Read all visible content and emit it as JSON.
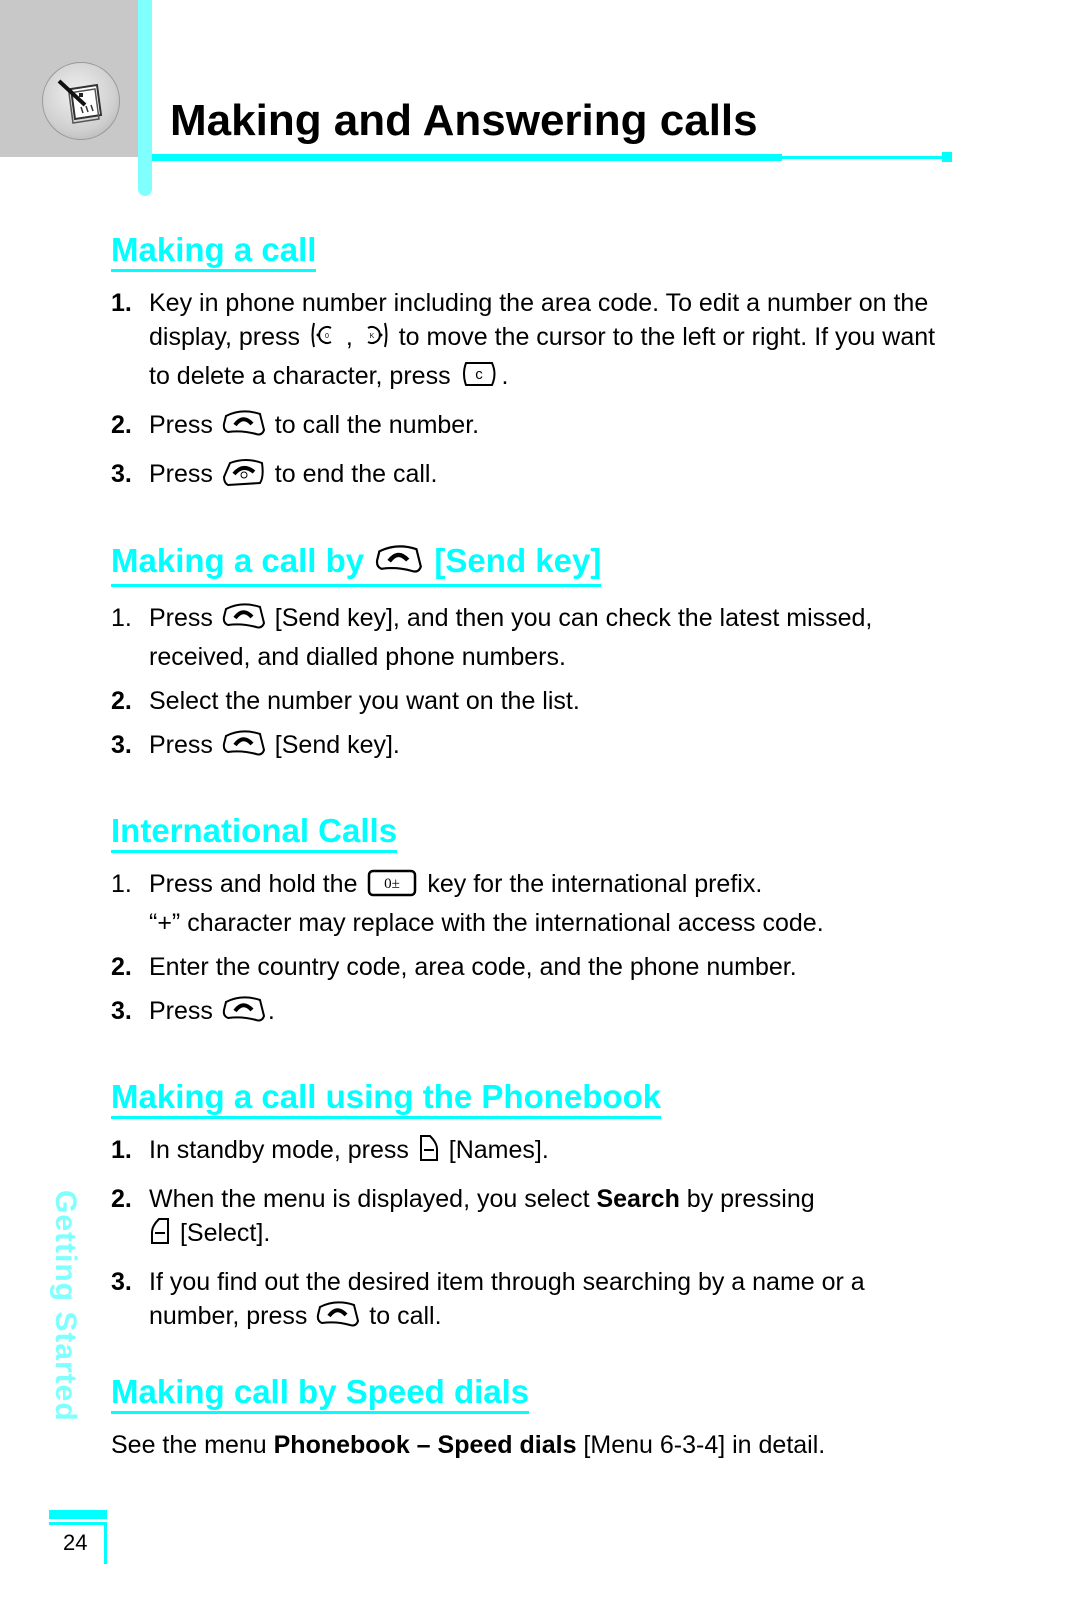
{
  "header": {
    "title": "Making and Answering calls",
    "chapter_icon": "notepad-pen-icon",
    "accent_color": "#00ffff"
  },
  "sections": [
    {
      "title": "Making a call",
      "steps": [
        {
          "num": "1.",
          "parts": [
            "Key in phone number including the area code. To edit a number on the display, press ",
            " , ",
            " to move the cursor to the left or right. If you want to delete a character, press ",
            "."
          ]
        },
        {
          "num": "2.",
          "parts": [
            "Press ",
            " to call the number."
          ]
        },
        {
          "num": "3.",
          "parts": [
            "Press ",
            " to end the call."
          ]
        }
      ]
    },
    {
      "title_before": "Making a call by ",
      "title_after": " [Send key]",
      "steps": [
        {
          "num": "1.",
          "parts": [
            "Press ",
            " [Send key], and then you can check the latest missed, received, and dialled phone numbers."
          ]
        },
        {
          "num": "2.",
          "parts": [
            "Select the number you want on the list."
          ]
        },
        {
          "num": "3.",
          "parts": [
            "Press ",
            " [Send key]."
          ]
        }
      ]
    },
    {
      "title": "International Calls",
      "steps": [
        {
          "num": "1.",
          "line1_parts": [
            "Press and hold the ",
            " key for the international prefix."
          ],
          "line2": "“+” character may replace with the international access code."
        },
        {
          "num": "2.",
          "parts": [
            "Enter the country code, area code, and the phone number."
          ]
        },
        {
          "num": "3.",
          "parts": [
            "Press ",
            "."
          ]
        }
      ]
    },
    {
      "title": "Making a call using the Phonebook",
      "steps": [
        {
          "num": "1.",
          "parts": [
            "In standby mode, press ",
            " [Names]."
          ]
        },
        {
          "num": "2.",
          "parts": [
            "When the menu is displayed, you select ",
            "Search",
            " by pressing ",
            " [Select]."
          ]
        },
        {
          "num": "3.",
          "parts": [
            "If you find out the desired item through searching by a name or a number, press ",
            " to call."
          ]
        }
      ]
    },
    {
      "title": "Making call by Speed dials",
      "paragraph": {
        "parts": [
          "See the menu ",
          "Phonebook – Speed dials",
          " [Menu 6-3-4] in detail."
        ]
      }
    }
  ],
  "keys": {
    "nav_left": "0",
    "nav_right": "K",
    "clear": "c",
    "intl": "0±"
  },
  "sidebar": {
    "chapter_label": "Getting Started",
    "page_number": "24"
  }
}
